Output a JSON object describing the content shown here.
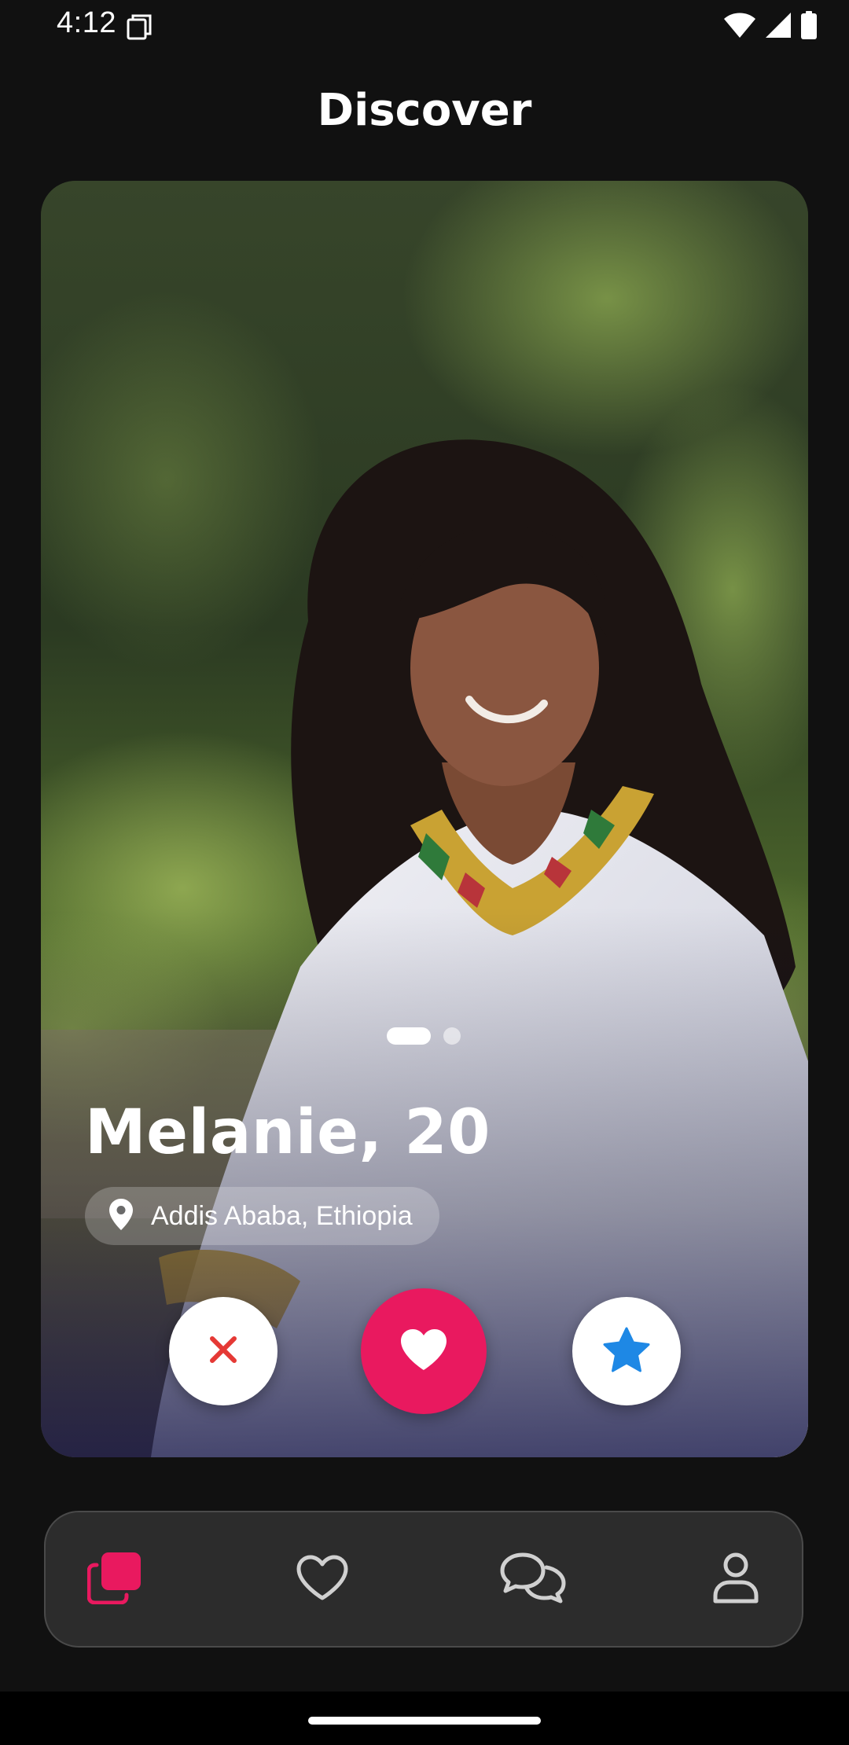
{
  "status_bar": {
    "time": "4:12",
    "icons": [
      "sim-card-icon",
      "wifi-icon",
      "cellular-signal-icon",
      "battery-icon"
    ]
  },
  "header": {
    "title": "Discover"
  },
  "profile_card": {
    "name_age": "Melanie, 20",
    "location": "Addis Ababa, Ethiopia",
    "location_icon": "map-pin-icon",
    "photo_count": 2,
    "active_photo_index": 0
  },
  "actions": [
    {
      "name": "dislike",
      "icon": "close-icon",
      "color": "#e53935",
      "background": "#ffffff"
    },
    {
      "name": "like",
      "icon": "heart-icon",
      "color": "#ffffff",
      "background": "#e9195f"
    },
    {
      "name": "superlike",
      "icon": "star-icon",
      "color": "#1e88e5",
      "background": "#ffffff"
    }
  ],
  "bottom_nav": {
    "items": [
      {
        "name": "discover",
        "icon": "cards-icon",
        "active": true
      },
      {
        "name": "likes",
        "icon": "heart-outline-icon",
        "active": false
      },
      {
        "name": "chats",
        "icon": "chat-bubbles-icon",
        "active": false
      },
      {
        "name": "profile",
        "icon": "person-icon",
        "active": false
      }
    ],
    "active_color": "#e9195f",
    "inactive_color": "#d0d0d0"
  },
  "colors": {
    "background": "#111111",
    "accent": "#e9195f",
    "nav_background": "#2c2c2c"
  }
}
